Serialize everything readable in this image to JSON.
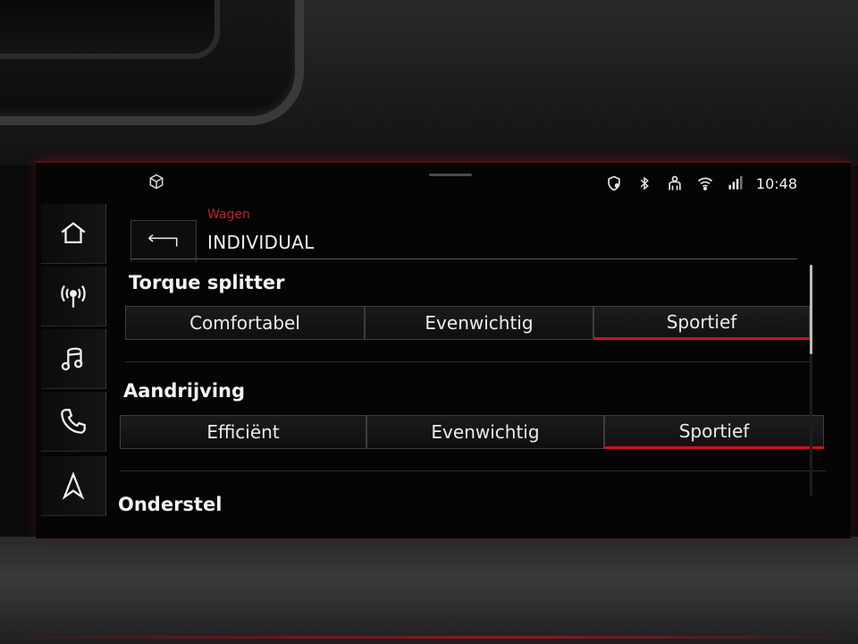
{
  "status": {
    "time": "10:48",
    "icons": [
      "cube-icon",
      "location-shield-icon",
      "bluetooth-icon",
      "person-icon",
      "wifi-icon",
      "lte-icon"
    ]
  },
  "nav": {
    "items": [
      {
        "name": "home-icon"
      },
      {
        "name": "radio-icon"
      },
      {
        "name": "music-icon"
      },
      {
        "name": "phone-icon"
      },
      {
        "name": "navigation-icon"
      }
    ]
  },
  "header": {
    "breadcrumb": "Wagen",
    "title": "INDIVIDUAL"
  },
  "sections": [
    {
      "title": "Torque splitter",
      "options": [
        "Comfortabel",
        "Evenwichtig",
        "Sportief"
      ],
      "selected": "Sportief"
    },
    {
      "title": "Aandrijving",
      "options": [
        "Efficiënt",
        "Evenwichtig",
        "Sportief"
      ],
      "selected": "Sportief"
    },
    {
      "title": "Onderstel"
    }
  ],
  "colors": {
    "accent": "#d0101d",
    "breadcrumb": "#c3202a"
  }
}
